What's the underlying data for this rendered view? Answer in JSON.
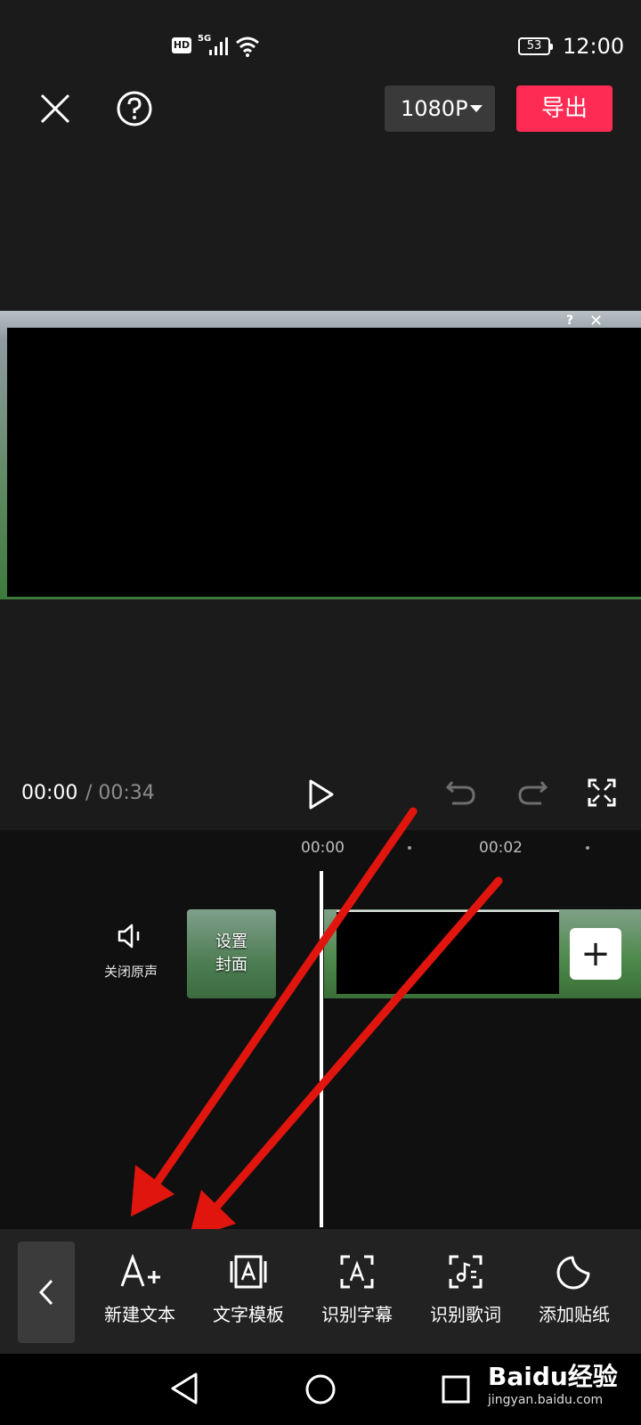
{
  "status_bar": {
    "hd": "HD",
    "network": "5G",
    "battery": "53",
    "time": "12:00"
  },
  "top_bar": {
    "resolution": "1080P",
    "export_label": "导出"
  },
  "preview": {
    "help_glyph": "?",
    "close_glyph": "✕"
  },
  "playback": {
    "current_time": "00:00",
    "total_time": "/ 00:34"
  },
  "timeline": {
    "ruler": [
      "00:00",
      "00:02"
    ],
    "mute_label": "关闭原声",
    "cover_label_line1": "设置",
    "cover_label_line2": "封面",
    "add_glyph": "+"
  },
  "toolbar": {
    "items": [
      {
        "label": "新建文本",
        "icon": "text-add-icon"
      },
      {
        "label": "文字模板",
        "icon": "text-template-icon"
      },
      {
        "label": "识别字幕",
        "icon": "recognize-subtitle-icon"
      },
      {
        "label": "识别歌词",
        "icon": "recognize-lyrics-icon"
      },
      {
        "label": "添加贴纸",
        "icon": "sticker-icon"
      }
    ]
  },
  "watermark": {
    "main": "Baidu经验",
    "sub": "jingyan.baidu.com"
  },
  "colors": {
    "accent": "#fe2c55",
    "arrow": "#e0150e",
    "background": "#1b1b1b"
  }
}
